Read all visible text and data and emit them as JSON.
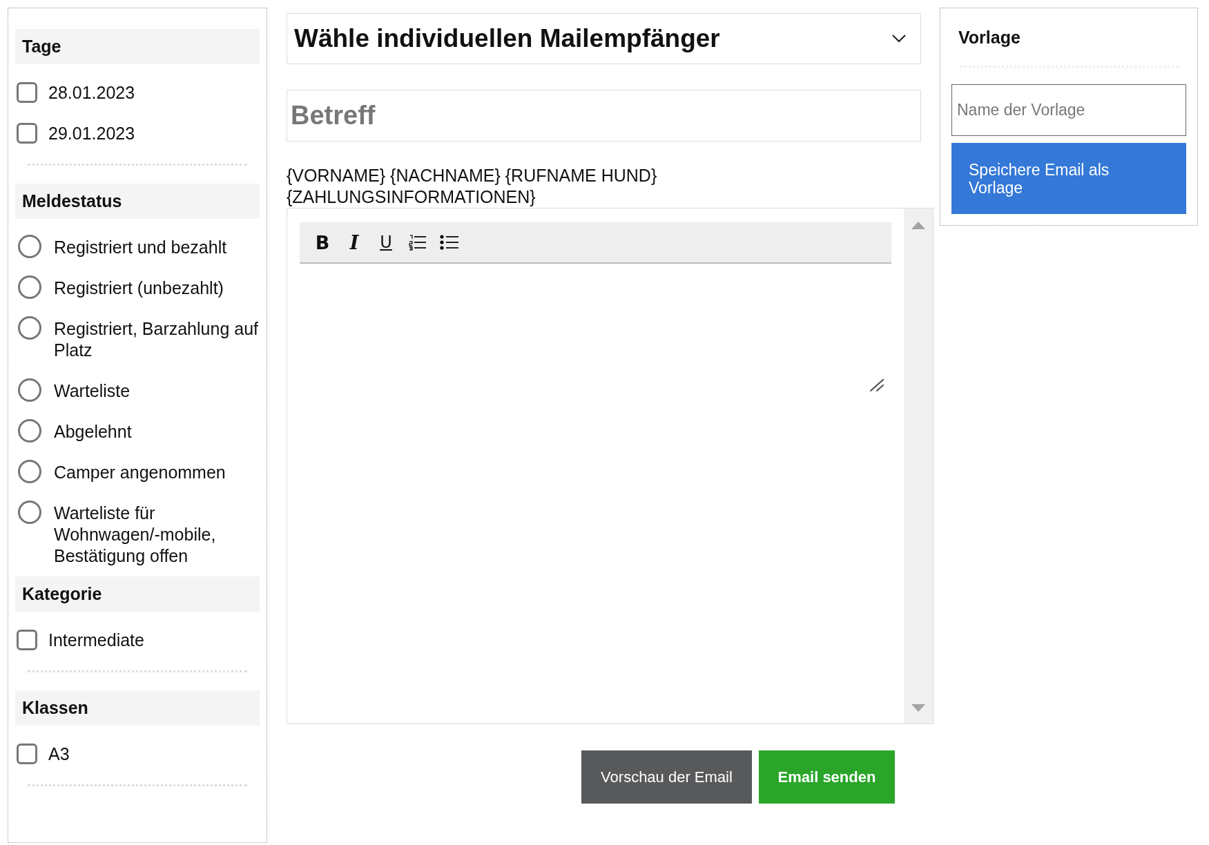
{
  "sidebar": {
    "sections": [
      {
        "title": "Tage",
        "kind": "checkbox",
        "options": [
          {
            "label": "28.01.2023",
            "checked": false
          },
          {
            "label": "29.01.2023",
            "checked": false
          }
        ]
      },
      {
        "title": "Meldestatus",
        "kind": "radio",
        "options": [
          {
            "label": "Registriert und bezahlt",
            "selected": false
          },
          {
            "label": "Registriert (unbezahlt)",
            "selected": false
          },
          {
            "label": "Registriert, Barzahlung auf Platz",
            "selected": false
          },
          {
            "label": "Warteliste",
            "selected": false
          },
          {
            "label": "Abgelehnt",
            "selected": false
          },
          {
            "label": "Camper angenommen",
            "selected": false
          },
          {
            "label": "Warteliste für Wohnwagen/-mobile, Bestätigung offen",
            "selected": false
          }
        ]
      },
      {
        "title": "Kategorie",
        "kind": "checkbox",
        "options": [
          {
            "label": "Intermediate",
            "checked": false
          }
        ]
      },
      {
        "title": "Klassen",
        "kind": "checkbox",
        "options": [
          {
            "label": "A3",
            "checked": false
          }
        ]
      }
    ]
  },
  "recipient_dropdown": {
    "value": "Wähle individuellen Mailempfänger"
  },
  "subject": {
    "placeholder": "Betreff"
  },
  "merge_fields": [
    "{VORNAME} {NACHNAME} {RUFNAME HUND}",
    "{ZAHLUNGSINFORMATIONEN}"
  ],
  "editor": {
    "toolbar": [
      {
        "kind": "bold",
        "label": "B"
      },
      {
        "kind": "italic",
        "label": "I"
      },
      {
        "kind": "underline",
        "label": "U"
      },
      {
        "kind": "ordered-list"
      },
      {
        "kind": "bullet-list"
      }
    ]
  },
  "buttons": [
    {
      "kind": "secondary",
      "label": "Vorschau der Email"
    },
    {
      "kind": "primary",
      "label": "Email senden"
    }
  ],
  "template": {
    "title": "Vorlage",
    "name_placeholder": "Name der Vorlage",
    "save_button": "Speichere Email als Vorlage"
  }
}
